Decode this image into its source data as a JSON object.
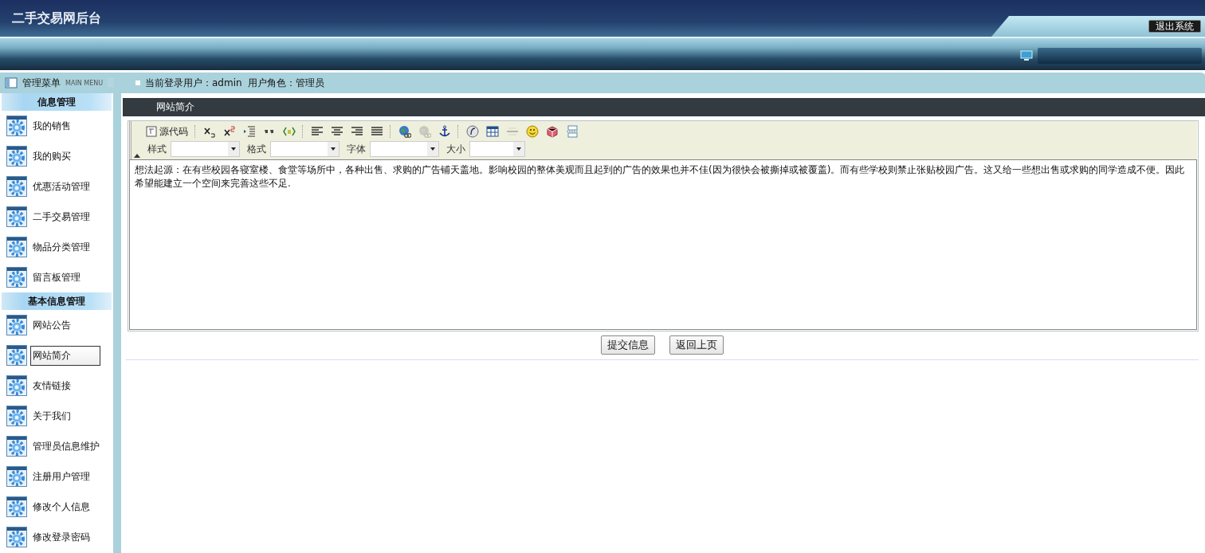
{
  "header": {
    "title": "二手交易网后台",
    "logout": "退出系统"
  },
  "menu": {
    "title": "管理菜单",
    "subtitle": "MAIN MENU"
  },
  "user_info": "当前登录用户：admin  用户角色：管理员",
  "sections": [
    {
      "title": "信息管理",
      "items": [
        {
          "label": "我的销售",
          "selected": false
        },
        {
          "label": "我的购买",
          "selected": false
        },
        {
          "label": "优惠活动管理",
          "selected": false
        },
        {
          "label": "二手交易管理",
          "selected": false
        },
        {
          "label": "物品分类管理",
          "selected": false
        },
        {
          "label": "留言板管理",
          "selected": false
        }
      ]
    },
    {
      "title": "基本信息管理",
      "items": [
        {
          "label": "网站公告",
          "selected": false
        },
        {
          "label": "网站简介",
          "selected": true
        },
        {
          "label": "友情链接",
          "selected": false
        },
        {
          "label": "关于我们",
          "selected": false
        },
        {
          "label": "管理员信息维护",
          "selected": false
        },
        {
          "label": "注册用户管理",
          "selected": false
        },
        {
          "label": "修改个人信息",
          "selected": false
        },
        {
          "label": "修改登录密码",
          "selected": false
        }
      ]
    }
  ],
  "panel_title": "网站简介",
  "editor": {
    "source_label": "源代码",
    "tool_groups": [
      [
        {
          "kind": "subscript",
          "disabled": false
        },
        {
          "kind": "superscript",
          "disabled": false
        },
        {
          "kind": "indent",
          "disabled": false
        },
        {
          "kind": "quote",
          "disabled": false
        },
        {
          "kind": "template",
          "disabled": false
        }
      ],
      [
        {
          "kind": "align-left",
          "disabled": false
        },
        {
          "kind": "align-center",
          "disabled": false
        },
        {
          "kind": "align-right",
          "disabled": false
        },
        {
          "kind": "justify",
          "disabled": false
        }
      ],
      [
        {
          "kind": "link",
          "disabled": false
        },
        {
          "kind": "unlink",
          "disabled": true
        },
        {
          "kind": "anchor",
          "disabled": false
        }
      ],
      [
        {
          "kind": "flash",
          "disabled": false
        },
        {
          "kind": "table",
          "disabled": false
        },
        {
          "kind": "rule",
          "disabled": true
        },
        {
          "kind": "smiley",
          "disabled": false
        },
        {
          "kind": "special-char",
          "disabled": false
        },
        {
          "kind": "page-break",
          "disabled": false
        }
      ]
    ],
    "dropdowns": [
      {
        "label": "样式"
      },
      {
        "label": "格式"
      },
      {
        "label": "字体"
      },
      {
        "label": "大小"
      }
    ],
    "content": "想法起源：在有些校园各寝室楼、食堂等场所中，各种出售、求购的广告铺天盖地。影响校园的整体美观而且起到的广告的效果也并不佳(因为很快会被撕掉或被覆盖)。而有些学校则禁止张贴校园广告。这又给一些想出售或求购的同学造成不便。因此希望能建立一个空间来完善这些不足."
  },
  "buttons": [
    "提交信息",
    "返回上页"
  ]
}
